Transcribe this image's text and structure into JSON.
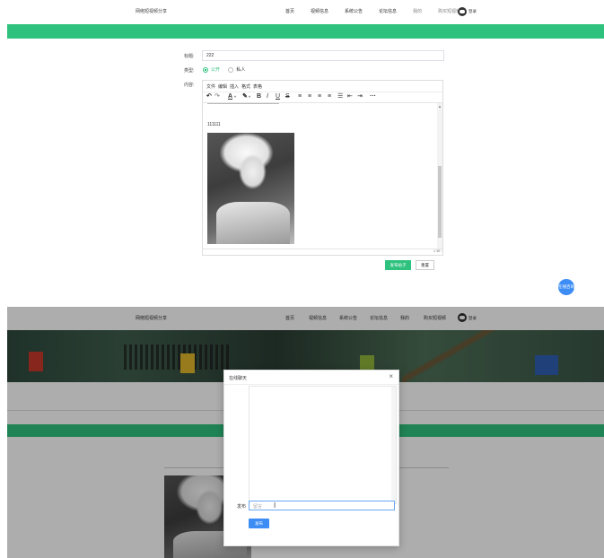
{
  "top": {
    "nav": {
      "brand": "网络短视频分享",
      "links": [
        "首页",
        "视频信息",
        "系统公告",
        "论坛信息",
        "我的",
        "购买短视频"
      ],
      "user_label": "登录"
    },
    "form": {
      "title_label": "标题:",
      "title_value": "222",
      "type_label": "类型:",
      "type_options": [
        "公开",
        "私人"
      ],
      "type_selected": "公开",
      "content_label": "内容:"
    },
    "editor": {
      "menu": [
        "文件",
        "编辑",
        "插入",
        "格式",
        "表格"
      ],
      "body_text": "111111",
      "image_alt": "portrait photo",
      "status_right": "1 W"
    },
    "buttons": {
      "submit": "发布帖子",
      "reset": "重置"
    },
    "chat_bubble": "在线咨询"
  },
  "bottom": {
    "nav": {
      "brand": "网络短视频分享",
      "links": [
        "首页",
        "视频信息",
        "系统公告",
        "论坛信息",
        "我的",
        "购买短视频"
      ],
      "user_label": "登录"
    },
    "modal": {
      "title": "在线聊天",
      "close": "×",
      "send_label": "发布",
      "input_placeholder": "留言",
      "send_button": "发布"
    }
  },
  "colors": {
    "accent_green": "#2ec27e",
    "accent_blue": "#3d8df5"
  }
}
